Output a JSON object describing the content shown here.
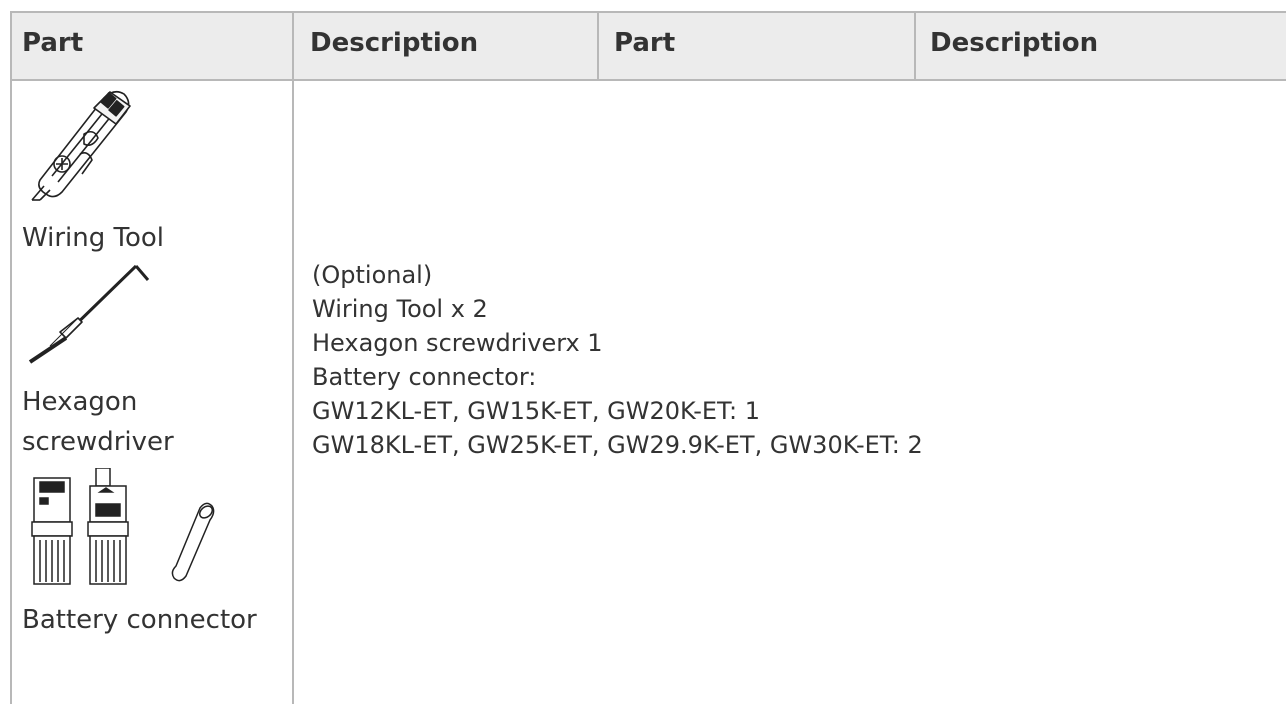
{
  "table": {
    "headers": [
      "Part",
      "Description",
      "Part",
      "Description"
    ],
    "row": {
      "parts": [
        {
          "icon": "wiring-tool-icon",
          "label": "Wiring Tool"
        },
        {
          "icon": "hexagon-screwdriver-icon",
          "label": "Hexagon screwdriver"
        },
        {
          "icon": "battery-connector-icon",
          "label": "Battery connector"
        }
      ],
      "description_lines": [
        "(Optional)",
        "Wiring Tool x 2",
        "Hexagon screwdriverx 1",
        "Battery connector:",
        "GW12KL-ET, GW15K-ET, GW20K-ET: 1",
        "GW18KL-ET, GW25K-ET, GW29.9K-ET, GW30K-ET: 2"
      ]
    }
  }
}
